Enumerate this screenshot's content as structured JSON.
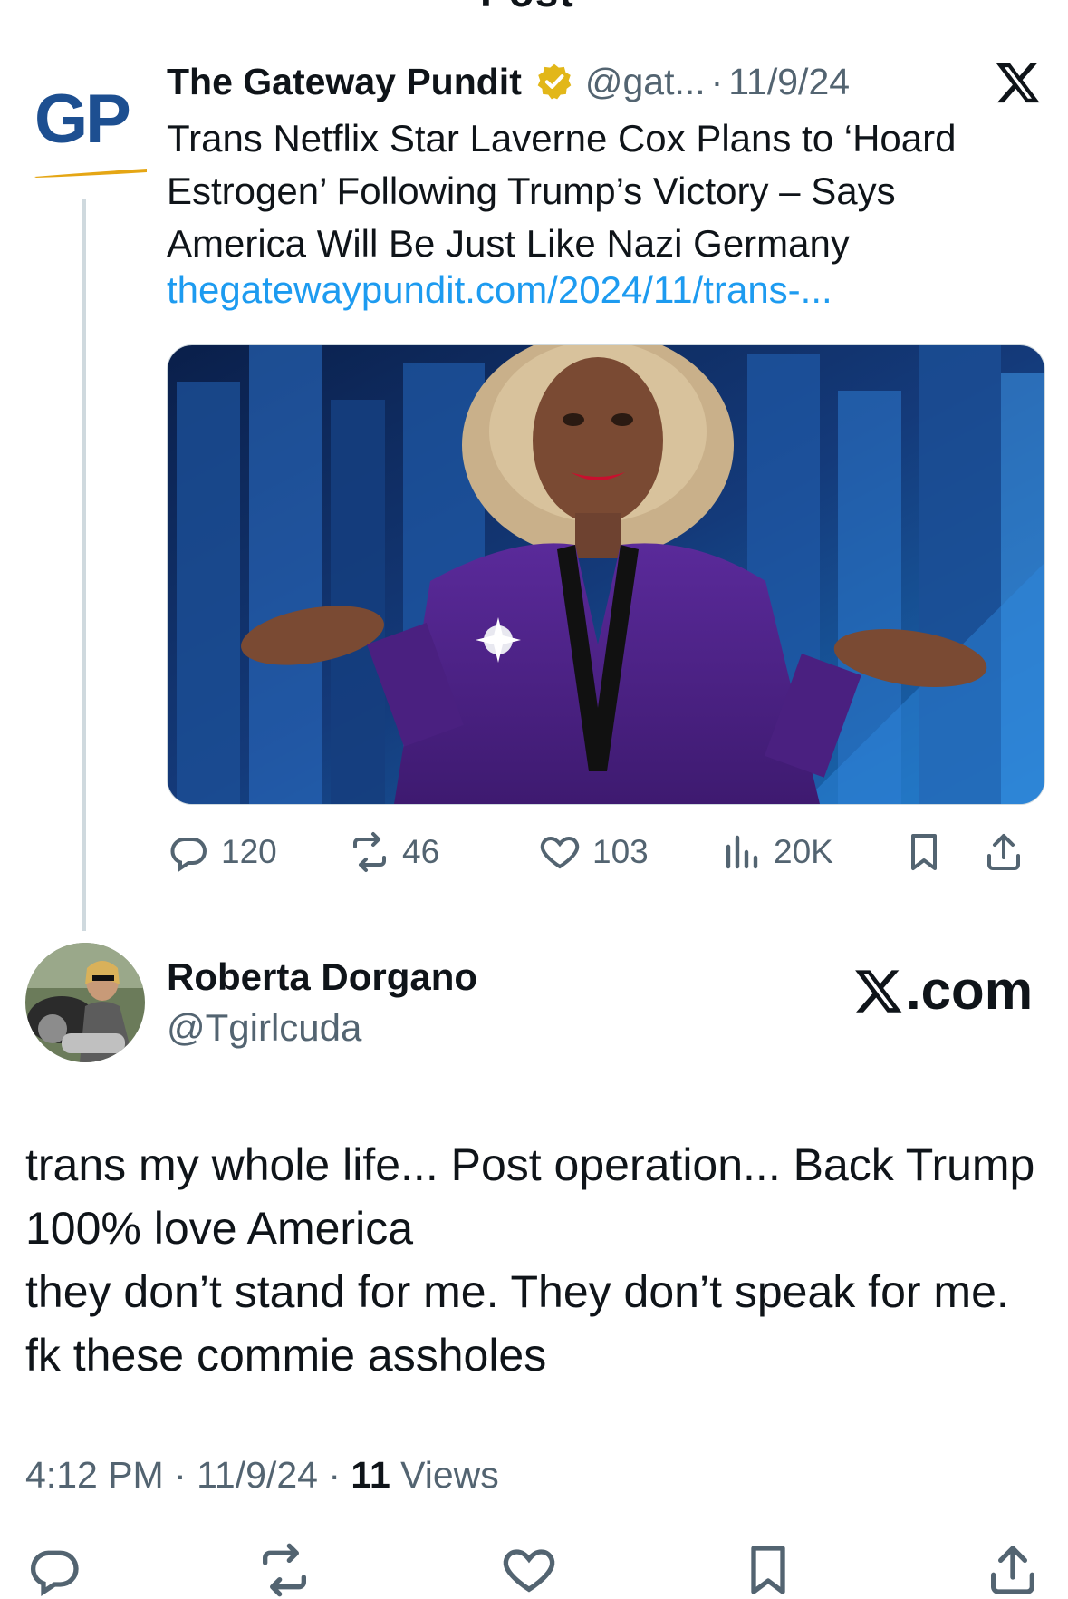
{
  "header": {
    "title": "Post"
  },
  "quoted_post": {
    "author_name": "The Gateway Pundit",
    "avatar_text": "GP",
    "handle": "@gat...",
    "separator": "·",
    "date": "11/9/24",
    "text": "Trans Netflix Star Laverne Cox Plans to ‘Hoard Estrogen’ Following Trump’s Victory – Says America Will Be Just Like Nazi Germany",
    "link": "thegatewaypundit.com/2024/11/trans-...",
    "stats": {
      "replies": "120",
      "reposts": "46",
      "likes": "103",
      "views": "20K"
    }
  },
  "post": {
    "author_name": "Roberta Dorgano",
    "handle": "@Tgirlcuda",
    "watermark": ".com",
    "body": "trans my whole life... Post operation... Back Trump 100% love America\n they don’t stand for me. They don’t speak for me. fk these commie assholes",
    "time": "4:12 PM",
    "separator": "·",
    "date": "11/9/24",
    "views_count": "11",
    "views_label": "Views"
  },
  "colors": {
    "link": "#1d9bf0",
    "muted": "#536471",
    "verified_gold": "#e2b719",
    "gp_blue": "#1d4f91"
  }
}
